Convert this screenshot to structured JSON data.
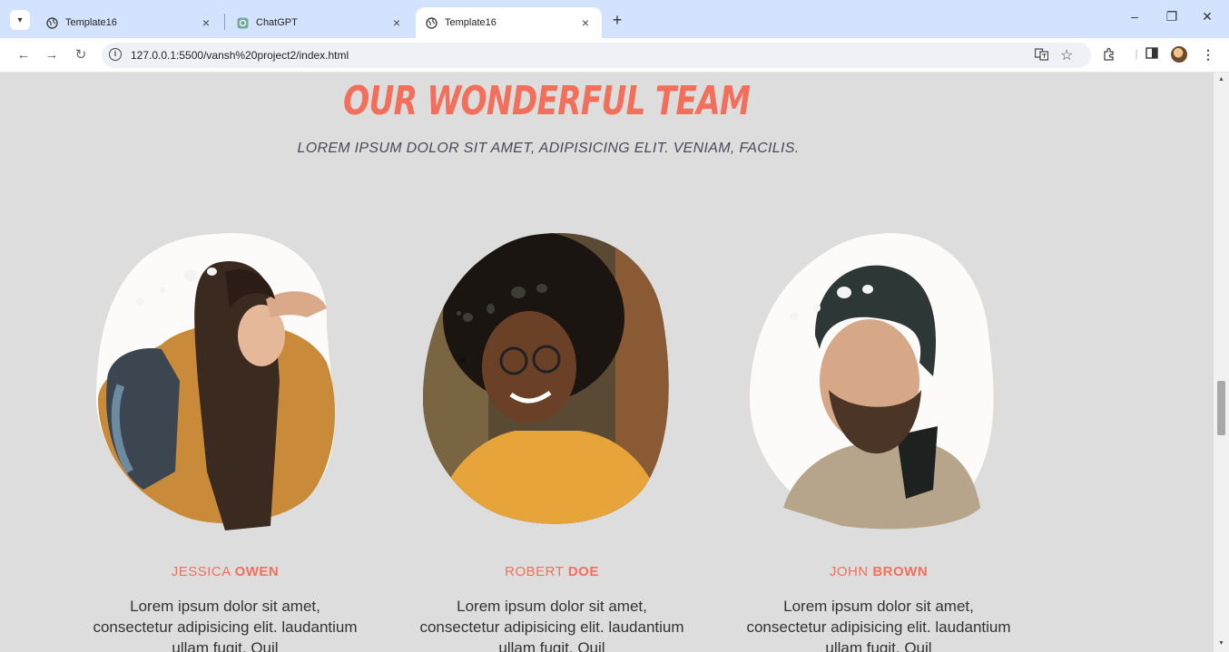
{
  "browser": {
    "tabs": [
      {
        "title": "Template16",
        "active": false
      },
      {
        "title": "ChatGPT",
        "active": false
      },
      {
        "title": "Template16",
        "active": true
      }
    ],
    "url": "127.0.0.1:5500/vansh%20project2/index.html"
  },
  "section": {
    "title": "OUR WONDERFUL TEAM",
    "subtitle": "LOREM IPSUM DOLOR SIT AMET, ADIPISICING ELIT. VENIAM, FACILIS."
  },
  "members": [
    {
      "first": "JESSICA",
      "last": "OWEN",
      "bio": "Lorem ipsum dolor sit amet, consectetur adipisicing elit. laudantium ullam fugit. Quil"
    },
    {
      "first": "ROBERT",
      "last": "DOE",
      "bio": "Lorem ipsum dolor sit amet, consectetur adipisicing elit. laudantium ullam fugit. Quil"
    },
    {
      "first": "JOHN",
      "last": "BROWN",
      "bio": "Lorem ipsum dolor sit amet, consectetur adipisicing elit. laudantium ullam fugit. Quil"
    }
  ],
  "colors": {
    "accent": "#f2705b",
    "page_bg": "#dddddd",
    "tabstrip": "#d3e3fd"
  }
}
